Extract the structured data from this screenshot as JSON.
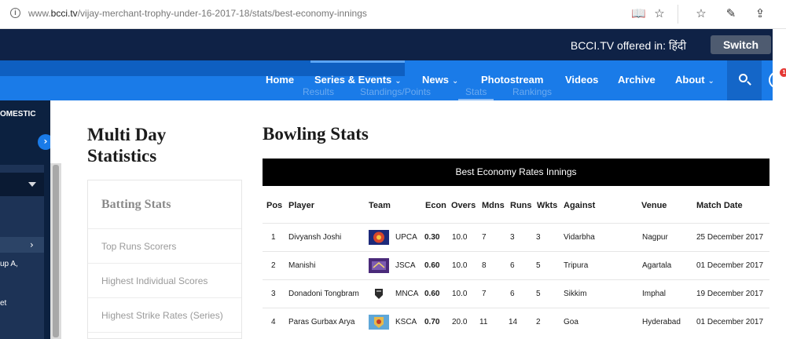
{
  "browser": {
    "url_prefix": "www.",
    "url_domain": "bcci.tv",
    "url_path": "/vijay-merchant-trophy-under-16-2017-18/stats/best-economy-innings",
    "icons": [
      "info-icon",
      "reading-view-icon",
      "favorite-star-icon",
      "favorites-list-icon",
      "pen-icon",
      "share-icon"
    ]
  },
  "topbar": {
    "offered_text": "BCCI.TV offered in: हिंदी",
    "switch_label": "Switch"
  },
  "nav": {
    "items": [
      "Home",
      "Series & Events",
      "News",
      "Photostream",
      "Videos",
      "Archive",
      "About"
    ],
    "chat_badge": "1"
  },
  "ghost_tabs": [
    "Results",
    "Standings/Points",
    "Stats",
    "Rankings"
  ],
  "left_panel": {
    "heading": "OMESTIC",
    "lines": [
      "up A,",
      "et"
    ]
  },
  "sidebar": {
    "title": "Multi Day Statistics",
    "section_title": "Batting Stats",
    "links": [
      "Top Runs Scorers",
      "Highest Individual Scores",
      "Highest Strike Rates (Series)"
    ]
  },
  "main": {
    "title": "Bowling Stats",
    "table_title": "Best Economy Rates Innings",
    "columns": [
      "Pos",
      "Player",
      "Team",
      "Econ",
      "Overs",
      "Mdns",
      "Runs",
      "Wkts",
      "Against",
      "Venue",
      "Match Date"
    ],
    "rows": [
      {
        "pos": "1",
        "player": "Divyansh Joshi",
        "team": "UPCA",
        "econ": "0.30",
        "overs": "10.0",
        "mdns": "7",
        "runs": "3",
        "wkts": "3",
        "against": "Vidarbha",
        "venue": "Nagpur",
        "date": "25 December 2017",
        "logo": "upca-logo-icon"
      },
      {
        "pos": "2",
        "player": "Manishi",
        "team": "JSCA",
        "econ": "0.60",
        "overs": "10.0",
        "mdns": "8",
        "runs": "6",
        "wkts": "5",
        "against": "Tripura",
        "venue": "Agartala",
        "date": "01 December 2017",
        "logo": "jsca-logo-icon"
      },
      {
        "pos": "3",
        "player": "Donadoni Tongbram",
        "team": "MNCA",
        "econ": "0.60",
        "overs": "10.0",
        "mdns": "7",
        "runs": "6",
        "wkts": "5",
        "against": "Sikkim",
        "venue": "Imphal",
        "date": "19 December 2017",
        "logo": "mnca-logo-icon"
      },
      {
        "pos": "4",
        "player": "Paras Gurbax Arya",
        "team": "KSCA",
        "econ": "0.70",
        "overs": "20.0",
        "mdns": "11",
        "runs": "14",
        "wkts": "2",
        "against": "Goa",
        "venue": "Hyderabad",
        "date": "01 December 2017",
        "logo": "ksca-logo-icon"
      }
    ]
  },
  "colors": {
    "topbar": "#0f2246",
    "nav": "#1a7be8",
    "accent_badge": "#e53935",
    "table_header_bar": "#000000"
  }
}
